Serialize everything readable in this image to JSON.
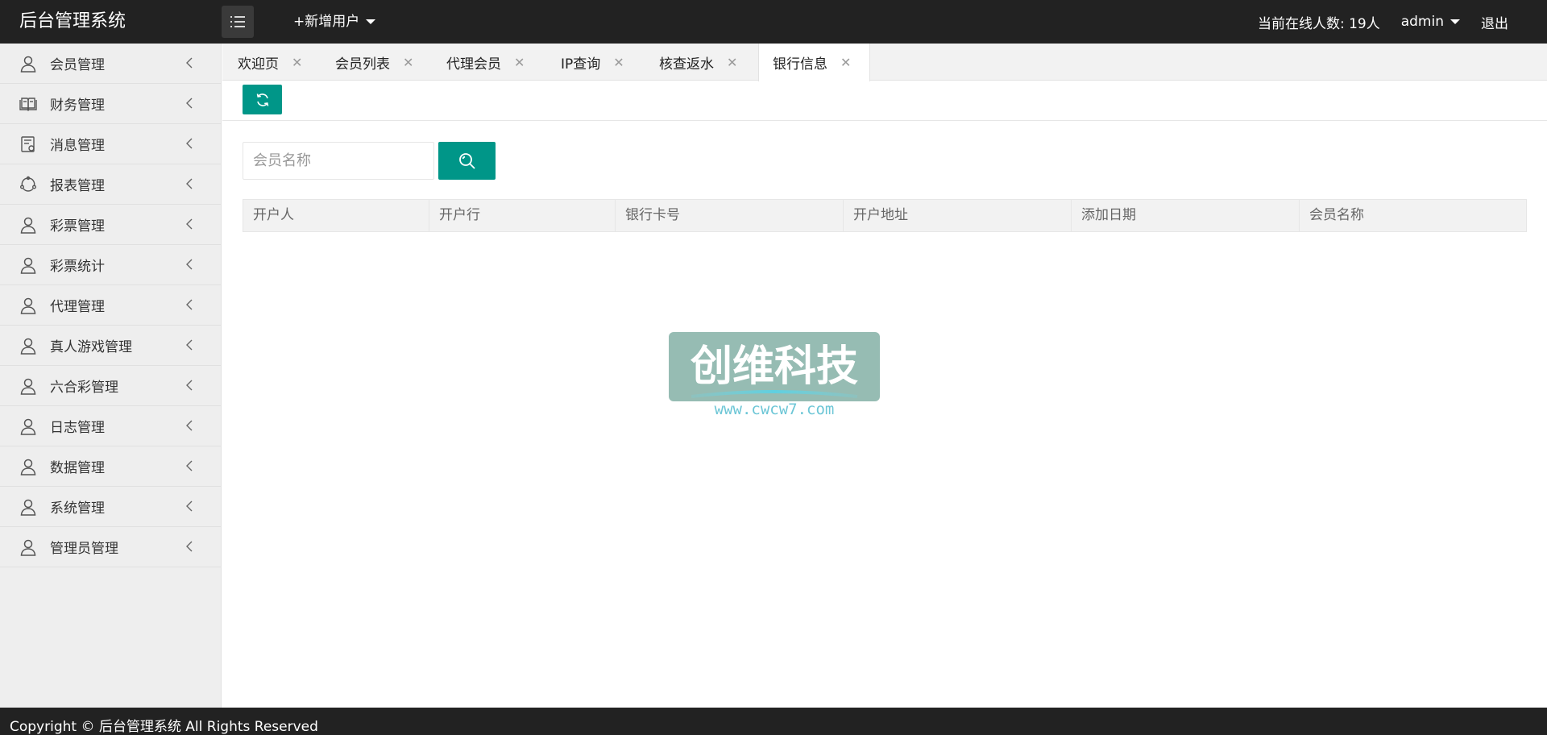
{
  "header": {
    "logo": "后台管理系统",
    "add_user": "+新增用户",
    "online_label": "当前在线人数: 19人",
    "admin": "admin",
    "logout": "退出"
  },
  "sidebar": {
    "items": [
      {
        "label": "会员管理",
        "icon": "user-icon"
      },
      {
        "label": "财务管理",
        "icon": "book-icon"
      },
      {
        "label": "消息管理",
        "icon": "message-icon"
      },
      {
        "label": "报表管理",
        "icon": "report-icon"
      },
      {
        "label": "彩票管理",
        "icon": "user-icon"
      },
      {
        "label": "彩票统计",
        "icon": "user-icon"
      },
      {
        "label": "代理管理",
        "icon": "user-icon"
      },
      {
        "label": "真人游戏管理",
        "icon": "user-icon"
      },
      {
        "label": "六合彩管理",
        "icon": "user-icon"
      },
      {
        "label": "日志管理",
        "icon": "user-icon"
      },
      {
        "label": "数据管理",
        "icon": "user-icon"
      },
      {
        "label": "系统管理",
        "icon": "user-icon"
      },
      {
        "label": "管理员管理",
        "icon": "user-icon"
      }
    ]
  },
  "tabs": [
    {
      "label": "欢迎页"
    },
    {
      "label": "会员列表"
    },
    {
      "label": "代理会员"
    },
    {
      "label": "IP查询"
    },
    {
      "label": "核查返水"
    },
    {
      "label": "银行信息",
      "active": true
    }
  ],
  "search": {
    "placeholder": "会员名称"
  },
  "table": {
    "columns": [
      "开户人",
      "开户行",
      "银行卡号",
      "开户地址",
      "添加日期",
      "会员名称"
    ],
    "rows": []
  },
  "watermark": {
    "title": "创维科技",
    "url": "www.cwcw7.com"
  },
  "footer": {
    "copyright": "Copyright © 后台管理系统 All Rights Reserved"
  },
  "colors": {
    "header_bg": "#222222",
    "accent": "#009688",
    "sidebar_bg": "#eeeeee",
    "tab_bar_bg": "#f2f2f2"
  }
}
